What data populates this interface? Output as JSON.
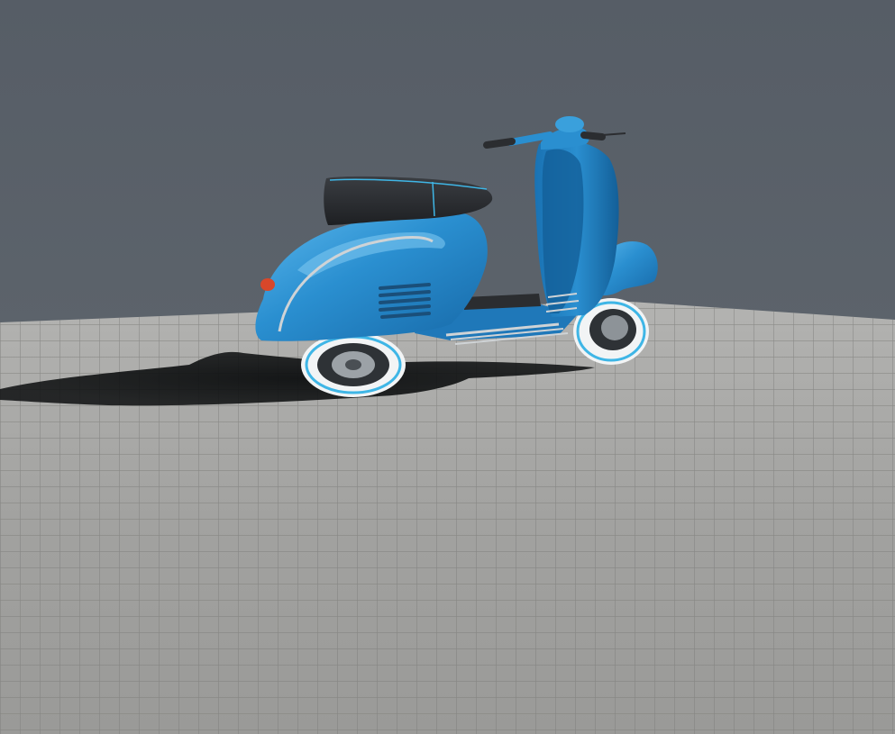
{
  "scene": {
    "subject": "scooter",
    "colors": {
      "backdrop": "#565d66",
      "floor": "#a7a7a5",
      "floor_grout": "#7d7d7b",
      "scooter_body": "#2a8fd0",
      "scooter_highlight": "#7cc6f0",
      "scooter_shadow_side": "#135f98",
      "seat": "#2b2d30",
      "tire_whitewall": "#f2f4f5",
      "tire_stripe": "#3fb6e6",
      "chrome": "#cfd3d6",
      "ground_shadow": "#0d0f10"
    }
  }
}
